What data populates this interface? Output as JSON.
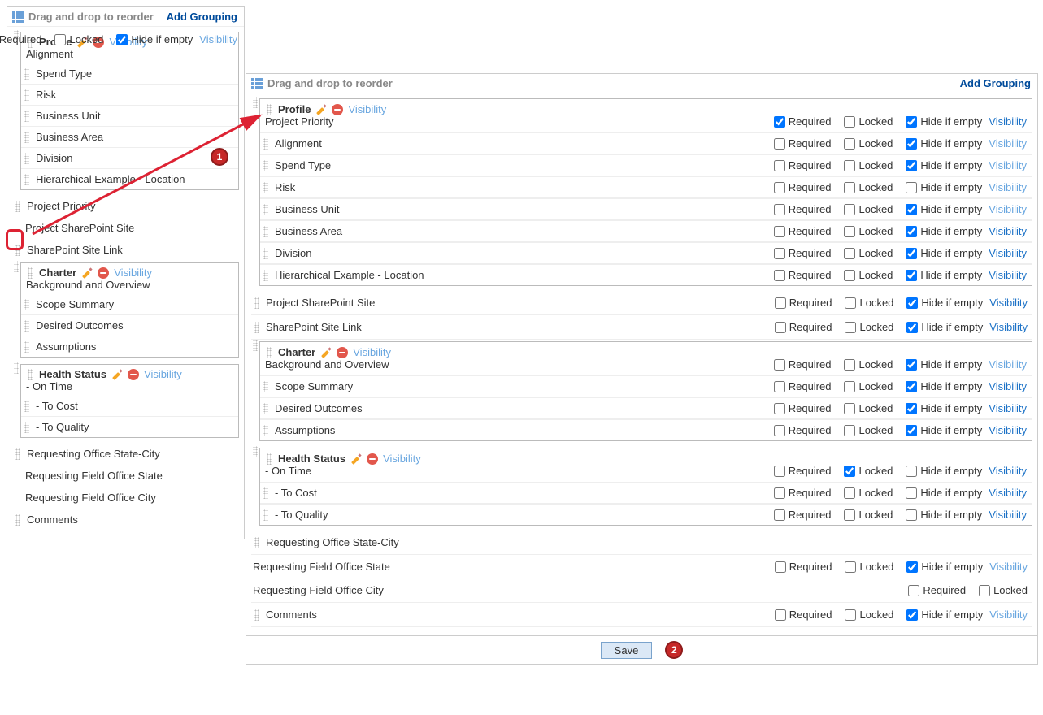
{
  "common": {
    "header_hint": "Drag and drop to reorder",
    "add_grouping": "Add Grouping",
    "visibility": "Visibility",
    "required": "Required",
    "locked": "Locked",
    "hide_if_empty": "Hide if empty",
    "save": "Save"
  },
  "callouts": {
    "one": "1",
    "two": "2"
  },
  "left": {
    "groups": [
      {
        "title": "Profile",
        "header_controls": {
          "required": false,
          "locked": false,
          "hide_if_empty": true
        },
        "first_field": "Alignment",
        "fields": [
          "Spend Type",
          "Risk",
          "Business Unit",
          "Business Area",
          "Division",
          "Hierarchical Example - Location"
        ]
      },
      {
        "title": "Charter",
        "first_field": "Background and Overview",
        "fields": [
          "Scope Summary",
          "Desired Outcomes",
          "Assumptions"
        ]
      },
      {
        "title": "Health Status",
        "first_field": "- On Time",
        "fields": [
          "- To Cost",
          "- To Quality"
        ]
      }
    ],
    "loose": {
      "project_priority": "Project Priority",
      "sp_site": "Project SharePoint Site",
      "sp_link": "SharePoint Site Link",
      "req_office": "Requesting Office State-City",
      "req_state": "Requesting Field Office State",
      "req_city": "Requesting Field Office City",
      "comments": "Comments"
    }
  },
  "right": {
    "profile": {
      "title": "Profile",
      "rows": [
        {
          "label": "Project Priority",
          "r": true,
          "l": false,
          "h": true,
          "dim": false
        },
        {
          "label": "Alignment",
          "r": false,
          "l": false,
          "h": true,
          "dim": true
        },
        {
          "label": "Spend Type",
          "r": false,
          "l": false,
          "h": true,
          "dim": true
        },
        {
          "label": "Risk",
          "r": false,
          "l": false,
          "h": false,
          "dim": true
        },
        {
          "label": "Business Unit",
          "r": false,
          "l": false,
          "h": true,
          "dim": true
        },
        {
          "label": "Business Area",
          "r": false,
          "l": false,
          "h": true,
          "dim": false
        },
        {
          "label": "Division",
          "r": false,
          "l": false,
          "h": true,
          "dim": false
        },
        {
          "label": "Hierarchical Example - Location",
          "r": false,
          "l": false,
          "h": true,
          "dim": false
        }
      ]
    },
    "loose_upper": [
      {
        "label": "Project SharePoint Site",
        "r": false,
        "l": false,
        "h": true,
        "dim": false
      },
      {
        "label": "SharePoint Site Link",
        "r": false,
        "l": false,
        "h": true,
        "dim": false
      }
    ],
    "charter": {
      "title": "Charter",
      "rows": [
        {
          "label": "Background and Overview",
          "r": false,
          "l": false,
          "h": true,
          "dim": true
        },
        {
          "label": "Scope Summary",
          "r": false,
          "l": false,
          "h": true,
          "dim": false
        },
        {
          "label": "Desired Outcomes",
          "r": false,
          "l": false,
          "h": true,
          "dim": false
        },
        {
          "label": "Assumptions",
          "r": false,
          "l": false,
          "h": true,
          "dim": false
        }
      ]
    },
    "health": {
      "title": "Health Status",
      "rows": [
        {
          "label": "- On Time",
          "r": false,
          "l": true,
          "h": false,
          "dim": false
        },
        {
          "label": "- To Cost",
          "r": false,
          "l": false,
          "h": false,
          "dim": false
        },
        {
          "label": "- To Quality",
          "r": false,
          "l": false,
          "h": false,
          "dim": false
        }
      ]
    },
    "loose_lower": {
      "req_office": {
        "label": "Requesting Office State-City",
        "r": false,
        "l": false,
        "h": true,
        "dim": true
      },
      "req_state": {
        "label": "Requesting Field Office State",
        "controls": {
          "r": false,
          "l": false,
          "h": true
        },
        "dim": true
      },
      "req_city": {
        "label": "Requesting Field Office City",
        "r": false,
        "l": false
      },
      "comments": {
        "label": "Comments",
        "r": false,
        "l": false,
        "h": true,
        "dim": true
      }
    }
  }
}
